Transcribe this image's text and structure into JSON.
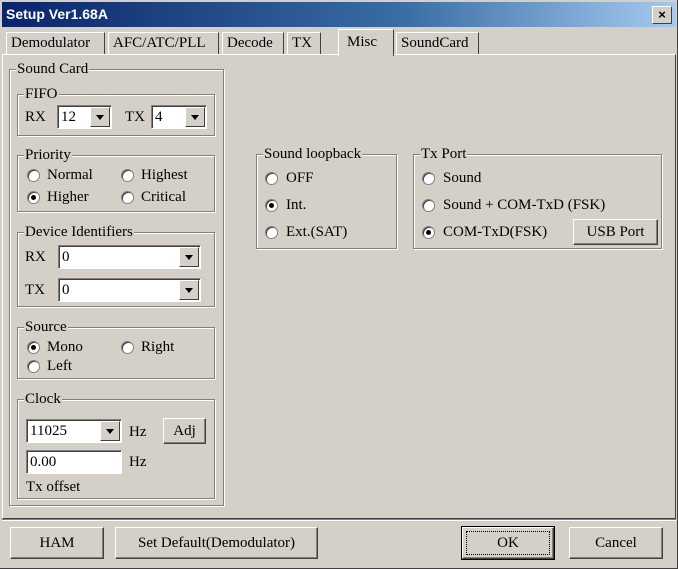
{
  "window": {
    "title": "Setup Ver1.68A",
    "close_label": "×"
  },
  "tabs": [
    {
      "label": "Demodulator"
    },
    {
      "label": "AFC/ATC/PLL"
    },
    {
      "label": "Decode"
    },
    {
      "label": "TX"
    },
    {
      "label": "Misc",
      "active": true
    },
    {
      "label": "SoundCard"
    }
  ],
  "sound_card": {
    "title": "Sound Card",
    "fifo": {
      "title": "FIFO",
      "rx_label": "RX",
      "rx_value": "12",
      "tx_label": "TX",
      "tx_value": "4"
    },
    "priority": {
      "title": "Priority",
      "options": [
        "Normal",
        "Highest",
        "Higher",
        "Critical"
      ],
      "selected": "Higher"
    },
    "device_identifiers": {
      "title": "Device Identifiers",
      "rx_label": "RX",
      "rx_value": "0",
      "tx_label": "TX",
      "tx_value": "0"
    },
    "source": {
      "title": "Source",
      "options": [
        "Mono",
        "Right",
        "Left"
      ],
      "selected": "Mono"
    },
    "clock": {
      "title": "Clock",
      "rate_value": "11025",
      "unit": "Hz",
      "adj_label": "Adj",
      "offset_value": "0.00",
      "offset_unit": "Hz",
      "offset_label": "Tx offset"
    }
  },
  "sound_loopback": {
    "title": "Sound loopback",
    "options": [
      "OFF",
      "Int.",
      "Ext.(SAT)"
    ],
    "selected": "Int."
  },
  "tx_port": {
    "title": "Tx Port",
    "options": [
      "Sound",
      "Sound + COM-TxD (FSK)",
      "COM-TxD(FSK)"
    ],
    "selected": "COM-TxD(FSK)",
    "usb_port_label": "USB Port"
  },
  "footer": {
    "ham_label": "HAM",
    "set_default_label": "Set Default(Demodulator)",
    "ok_label": "OK",
    "cancel_label": "Cancel"
  }
}
